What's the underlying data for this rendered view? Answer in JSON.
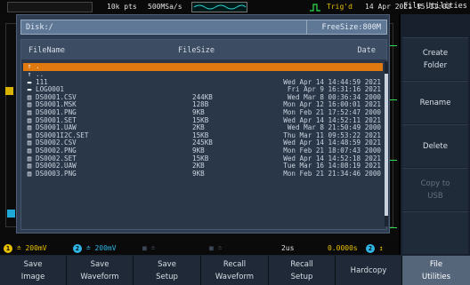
{
  "topbar": {
    "points": "10k pts",
    "sample_rate": "500MSa/s",
    "trigger_status": "Trig'd",
    "datetime": "14 Apr 2021 15:11:03"
  },
  "dialog": {
    "path": "Disk:/",
    "free_space": "FreeSize:800M",
    "col_filename": "FileName",
    "col_filesize": "FileSize",
    "col_date": "Date",
    "files": [
      {
        "icon": "up-arrow",
        "glyph": "↑",
        "name": ".",
        "size": "",
        "date": "",
        "selected": true
      },
      {
        "icon": "up-arrow",
        "glyph": "↑",
        "name": "..",
        "size": "",
        "date": "",
        "selected": false
      },
      {
        "icon": "folder",
        "glyph": "▬",
        "name": "111",
        "size": "",
        "date": "Wed Apr 14 14:44:59 2021",
        "selected": false
      },
      {
        "icon": "folder",
        "glyph": "▬",
        "name": "LOG0001",
        "size": "",
        "date": "Fri Apr  9 16:31:16 2021",
        "selected": false
      },
      {
        "icon": "file",
        "glyph": "▤",
        "name": "DS0001.CSV",
        "size": "244KB",
        "date": "Wed Mar  8 00:36:34 2000",
        "selected": false
      },
      {
        "icon": "file",
        "glyph": "▤",
        "name": "DS0001.MSK",
        "size": "128B",
        "date": "Mon Apr 12 16:00:01 2021",
        "selected": false
      },
      {
        "icon": "file",
        "glyph": "▤",
        "name": "DS0001.PNG",
        "size": "9KB",
        "date": "Mon Feb 21 17:52:47 2000",
        "selected": false
      },
      {
        "icon": "file",
        "glyph": "▤",
        "name": "DS0001.SET",
        "size": "15KB",
        "date": "Wed Apr 14 14:52:11 2021",
        "selected": false
      },
      {
        "icon": "file",
        "glyph": "▤",
        "name": "DS0001.UAW",
        "size": "2KB",
        "date": "Wed Mar  8 21:50:49 2000",
        "selected": false
      },
      {
        "icon": "file",
        "glyph": "▤",
        "name": "DS0001I2C.SET",
        "size": "15KB",
        "date": "Thu Mar 11 09:53:22 2021",
        "selected": false
      },
      {
        "icon": "file",
        "glyph": "▤",
        "name": "DS0002.CSV",
        "size": "245KB",
        "date": "Wed Apr 14 14:48:59 2021",
        "selected": false
      },
      {
        "icon": "file",
        "glyph": "▤",
        "name": "DS0002.PNG",
        "size": "9KB",
        "date": "Mon Feb 21 18:07:43 2000",
        "selected": false
      },
      {
        "icon": "file",
        "glyph": "▤",
        "name": "DS0002.SET",
        "size": "15KB",
        "date": "Wed Apr 14 14:52:18 2021",
        "selected": false
      },
      {
        "icon": "file",
        "glyph": "▤",
        "name": "DS0002.UAW",
        "size": "2KB",
        "date": "Tue Mar 16 14:08:19 2021",
        "selected": false
      },
      {
        "icon": "file",
        "glyph": "▤",
        "name": "DS0003.PNG",
        "size": "9KB",
        "date": "Mon Feb 21 21:34:46 2000",
        "selected": false
      }
    ]
  },
  "side_menu": {
    "title": "File Utilities",
    "items": [
      {
        "line1": "Create",
        "line2": "Folder",
        "disabled": false
      },
      {
        "line1": "Rename",
        "line2": "",
        "disabled": false
      },
      {
        "line1": "Delete",
        "line2": "",
        "disabled": false
      },
      {
        "line1": "Copy to",
        "line2": "USB",
        "disabled": true
      }
    ]
  },
  "channel_bar": {
    "ch1_num": "1",
    "ch1_scale": "200mV",
    "ch2_num": "2",
    "ch2_scale": "200mV",
    "timebase": "2us",
    "position": "0.0000s",
    "trigger_ch": "2",
    "colors": {
      "ch1": "#e8c000",
      "ch2": "#2fb6e6",
      "position": "#e8c000",
      "trigger_icon": "#e8c000"
    }
  },
  "bottom_menu": [
    {
      "line1": "Save",
      "line2": "Image",
      "active": false
    },
    {
      "line1": "Save",
      "line2": "Waveform",
      "active": false
    },
    {
      "line1": "Save",
      "line2": "Setup",
      "active": false
    },
    {
      "line1": "Recall",
      "line2": "Waveform",
      "active": false
    },
    {
      "line1": "Recall",
      "line2": "Setup",
      "active": false
    },
    {
      "line1": "Hardcopy",
      "line2": "",
      "active": false
    },
    {
      "line1": "File",
      "line2": "Utilities",
      "active": true
    }
  ]
}
